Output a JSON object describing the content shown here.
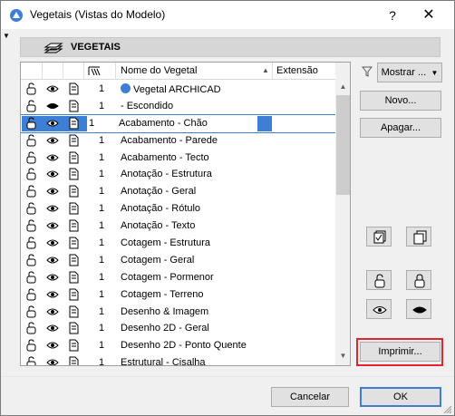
{
  "window": {
    "title": "Vegetais (Vistas do Modelo)",
    "help_label": "?",
    "close_label": "✕"
  },
  "header": {
    "title": "VEGETAIS"
  },
  "list": {
    "columns": {
      "name": "Nome do Vegetal",
      "extension": "Extensão"
    },
    "rows": [
      {
        "num": "1",
        "name": "Vegetal ARCHICAD"
      },
      {
        "num": "1",
        "name": "- Escondido"
      },
      {
        "num": "1",
        "name": "Acabamento - Chão"
      },
      {
        "num": "1",
        "name": "Acabamento - Parede"
      },
      {
        "num": "1",
        "name": "Acabamento - Tecto"
      },
      {
        "num": "1",
        "name": "Anotação - Estrutura"
      },
      {
        "num": "1",
        "name": "Anotação - Geral"
      },
      {
        "num": "1",
        "name": "Anotação - Rótulo"
      },
      {
        "num": "1",
        "name": "Anotação - Texto"
      },
      {
        "num": "1",
        "name": "Cotagem - Estrutura"
      },
      {
        "num": "1",
        "name": "Cotagem - Geral"
      },
      {
        "num": "1",
        "name": "Cotagem - Pormenor"
      },
      {
        "num": "1",
        "name": "Cotagem - Terreno"
      },
      {
        "num": "1",
        "name": "Desenho & Imagem"
      },
      {
        "num": "1",
        "name": "Desenho 2D - Geral"
      },
      {
        "num": "1",
        "name": "Desenho 2D - Ponto Quente"
      },
      {
        "num": "1",
        "name": "Estrutural - Cisalha"
      }
    ]
  },
  "buttons": {
    "show": "Mostrar ...",
    "new": "Novo...",
    "delete": "Apagar...",
    "print": "Imprimir...",
    "cancel": "Cancelar",
    "ok": "OK"
  },
  "icons": {
    "lock": "lock-open-icon",
    "eye": "eye-icon",
    "layer": "layer-page-icon",
    "filter": "filter-icon"
  },
  "colors": {
    "selection": "#3c7fd4",
    "highlight": "#e0262a"
  }
}
